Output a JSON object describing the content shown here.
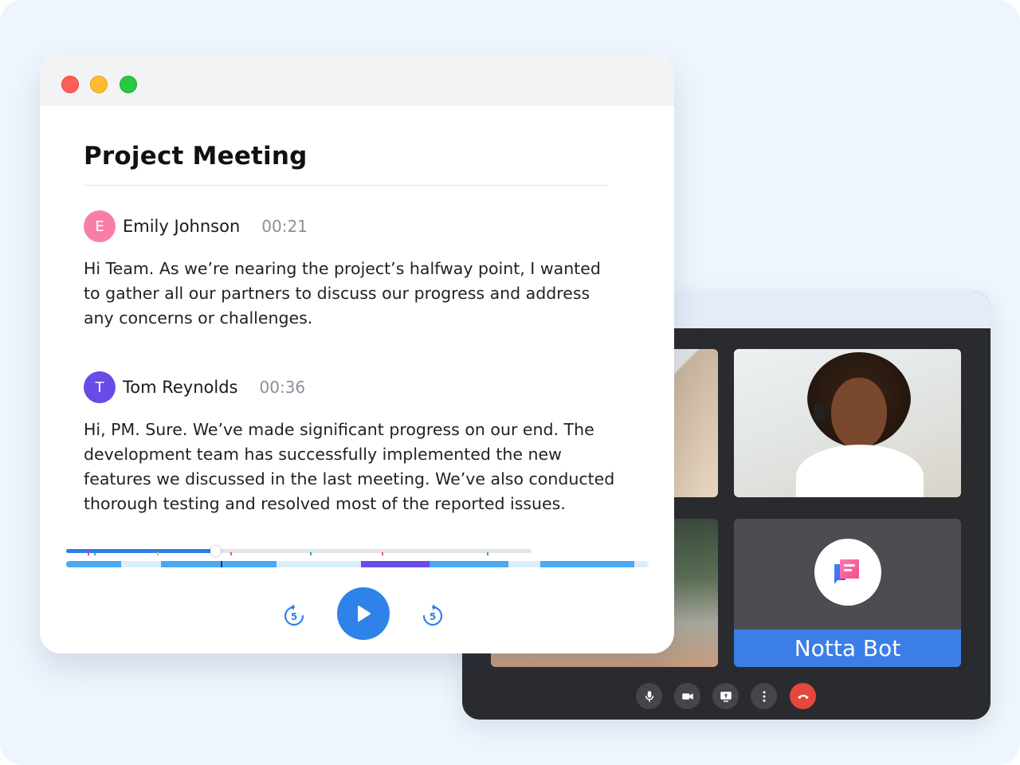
{
  "transcript": {
    "title": "Project Meeting",
    "entries": [
      {
        "initial": "E",
        "speaker": "Emily Johnson",
        "time": "00:21",
        "avatar_color": "#f77fa7",
        "text": "Hi Team. As we’re nearing the project’s halfway point, I wanted to gather all our partners to discuss our progress and address any concerns or challenges."
      },
      {
        "initial": "T",
        "speaker": "Tom Reynolds",
        "time": "00:36",
        "avatar_color": "#6a4be8",
        "text": "Hi, PM. Sure. We’ve made significant progress on our end. The development team has successfully implemented the new features we discussed in the last meeting. We’ve also conducted thorough testing and resolved most of the reported issues."
      }
    ],
    "player": {
      "skip_back_label": "5",
      "skip_forward_label": "5",
      "progress_fraction": 0.32
    }
  },
  "call": {
    "bot_name": "Notta Bot",
    "controls": [
      "microphone-icon",
      "camera-icon",
      "present-screen-icon",
      "more-options-icon",
      "end-call-icon"
    ],
    "end_call_color": "#e5463d"
  },
  "colors": {
    "accent": "#2f82e9",
    "bot_banner": "#3b7ee8",
    "speaker_segment": "#6a4be8"
  }
}
